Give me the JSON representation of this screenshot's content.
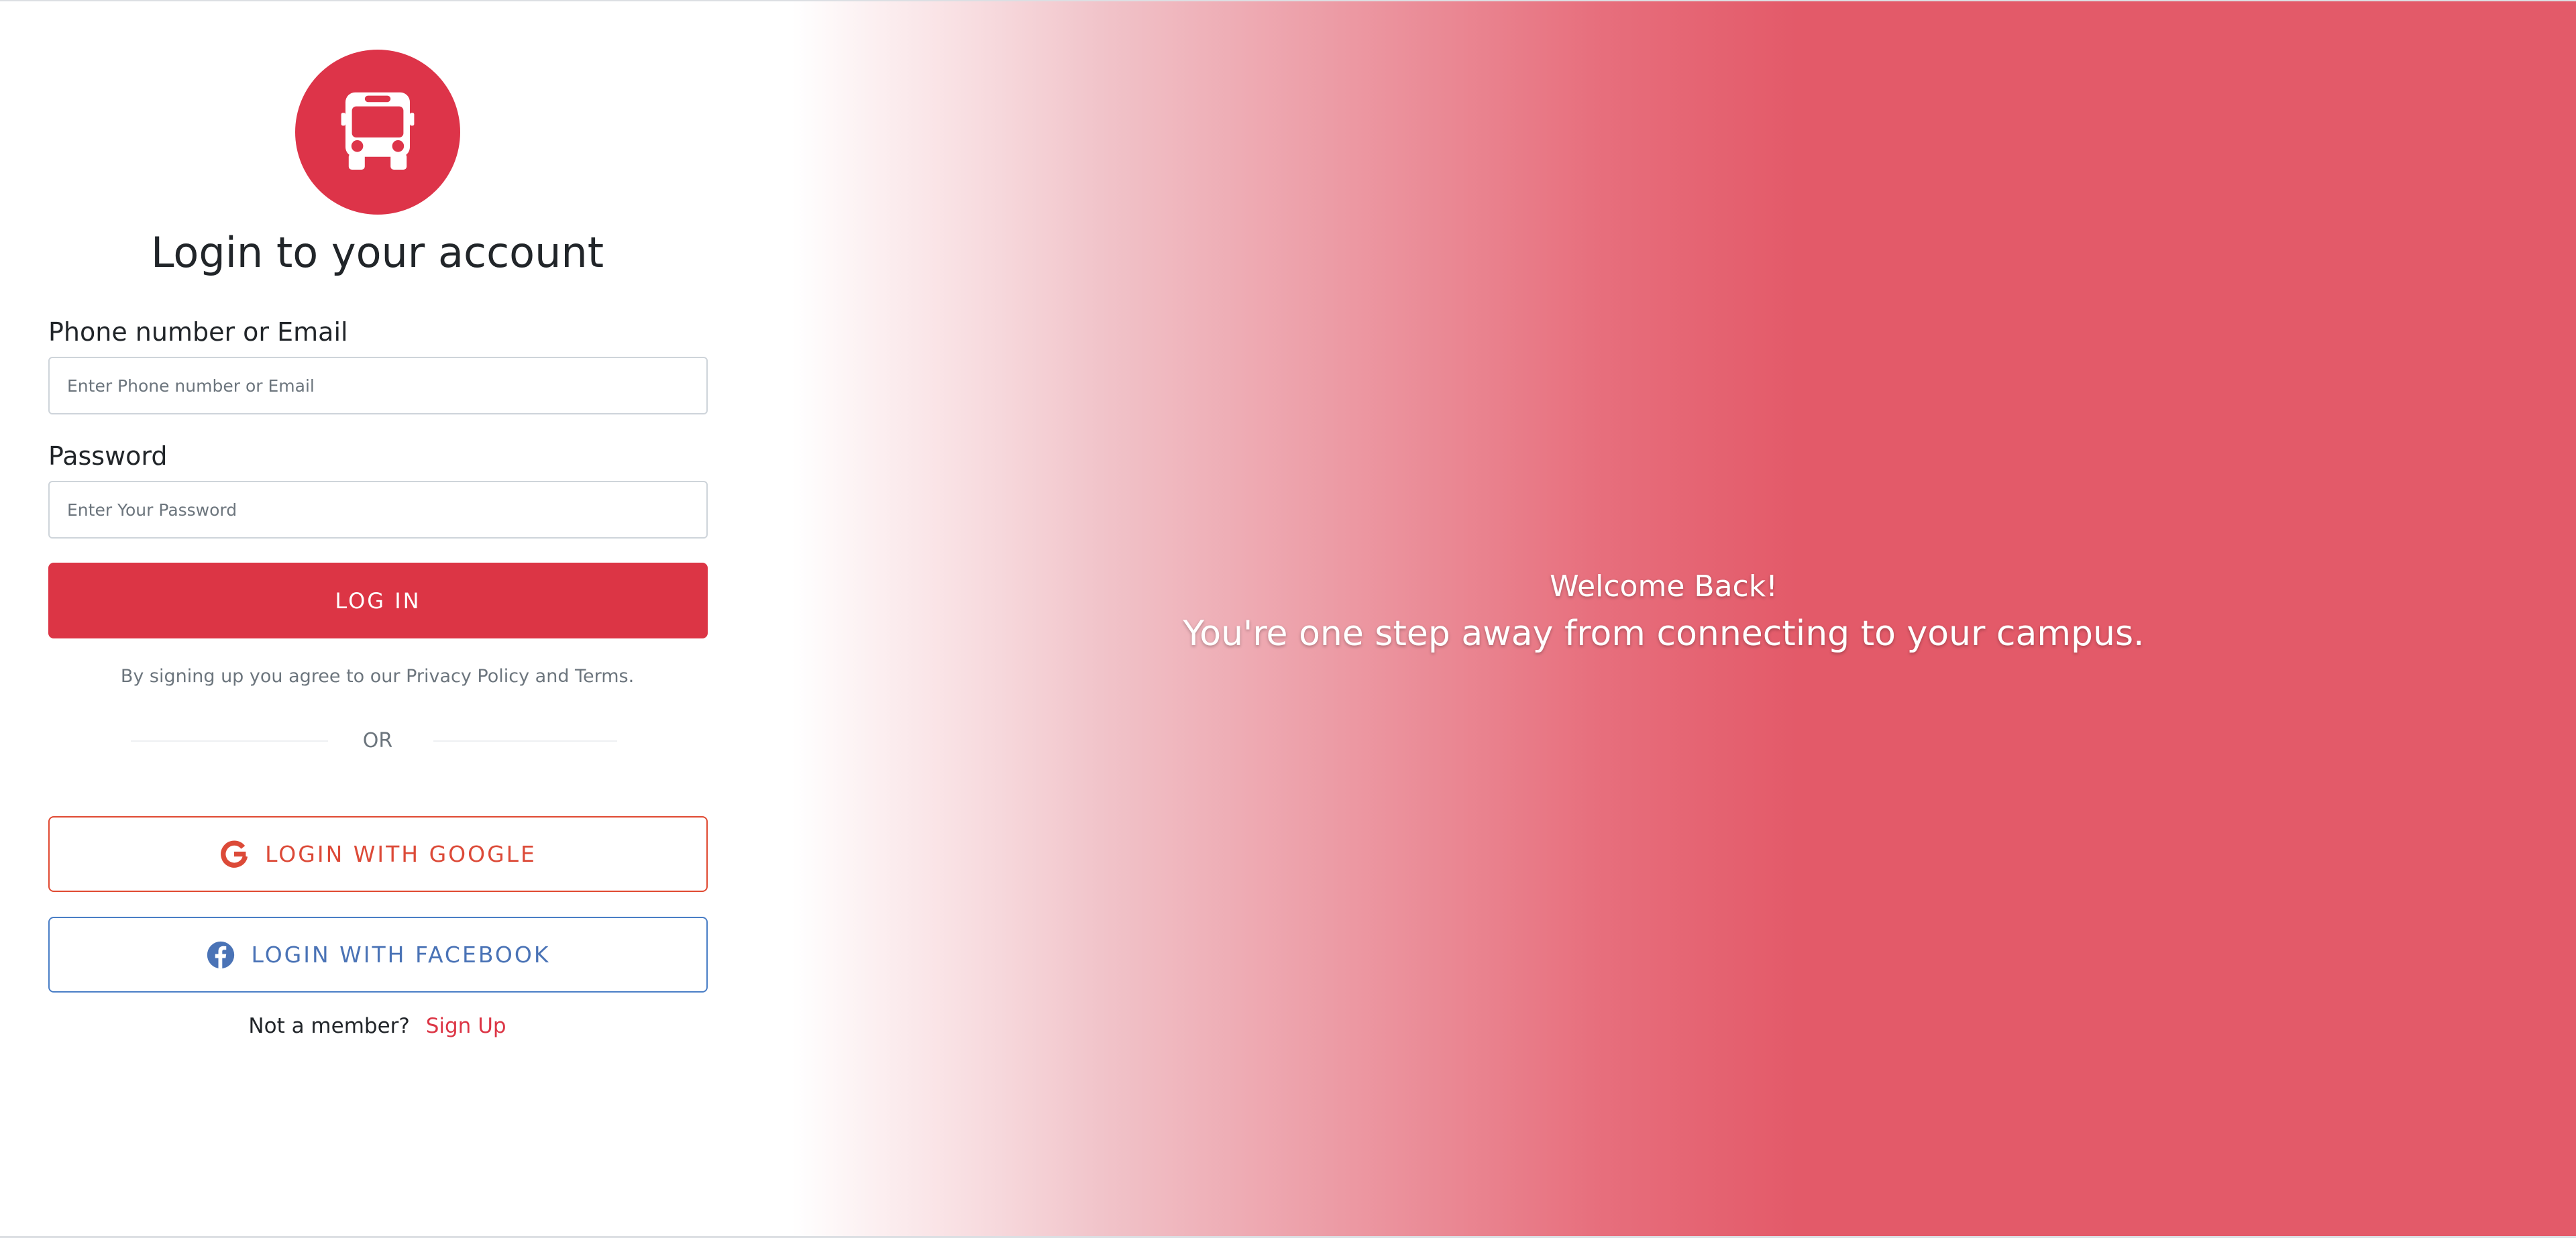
{
  "login": {
    "title": "Login to your account",
    "phone_label": "Phone number or Email",
    "phone_placeholder": "Enter Phone number or Email",
    "password_label": "Password",
    "password_placeholder": "Enter Your Password",
    "login_button": "LOG IN",
    "terms_text": "By signing up you agree to our Privacy Policy and Terms.",
    "divider_text": "OR",
    "google_button": "LOGIN WITH GOOGLE",
    "facebook_button": "LOGIN WITH FACEBOOK",
    "not_member_text": "Not a member?",
    "signup_link": "Sign Up"
  },
  "hero": {
    "welcome": "Welcome Back!",
    "tagline": "You're one step away from connecting to your campus."
  },
  "icons": {
    "logo": "bus-icon",
    "google": "google-icon",
    "facebook": "facebook-icon"
  },
  "colors": {
    "primary": "#dc3545",
    "hero_gradient_end": "#e35a69",
    "google": "#dc4a38",
    "facebook": "#4a73b6"
  }
}
